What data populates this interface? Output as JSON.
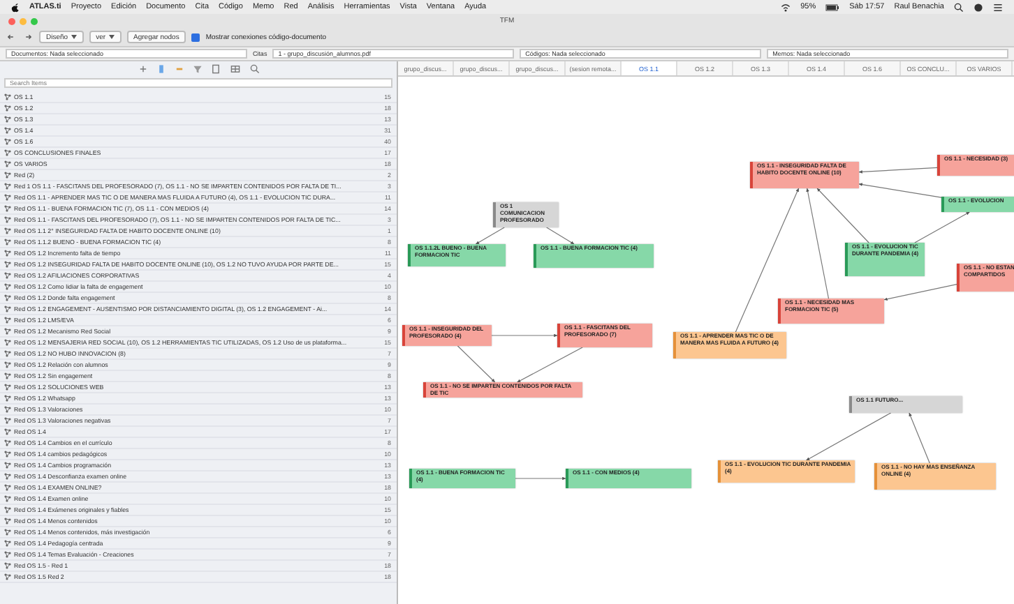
{
  "menu_bar": {
    "app": "ATLAS.ti",
    "items": [
      "Proyecto",
      "Edición",
      "Documento",
      "Cita",
      "Código",
      "Memo",
      "Red",
      "Análisis",
      "Herramientas",
      "Vista",
      "Ventana",
      "Ayuda"
    ],
    "battery": "95%",
    "clock": "Sáb 17:57",
    "user": "Raul Benachia"
  },
  "window": {
    "title": "TFM"
  },
  "toolbar": {
    "buttons": [
      {
        "label": "Diseño",
        "kind": "dropdown"
      },
      {
        "label": "ver",
        "kind": "dropdown"
      },
      {
        "label": "Agregar nodos",
        "kind": "button"
      }
    ],
    "checkbox": {
      "label": "Mostrar conexiones código-documento",
      "checked": true
    }
  },
  "filters": [
    {
      "value": "Documentos: Nada seleccionado"
    },
    {
      "label": "Citas",
      "value": "1 - grupo_discusión_alumnos.pdf"
    },
    {
      "value": "Códigos: Nada seleccionado"
    },
    {
      "value": "Memos: Nada seleccionado"
    }
  ],
  "sidebar": {
    "search": {
      "placeholder": "Search Items"
    },
    "items": [
      {
        "label": "OS 1.1",
        "count": "15"
      },
      {
        "label": "OS 1.2",
        "count": "18"
      },
      {
        "label": "OS 1.3",
        "count": "13"
      },
      {
        "label": "OS 1.4",
        "count": "31"
      },
      {
        "label": "OS 1.6",
        "count": "40"
      },
      {
        "label": "OS CONCLUSIONES FINALES",
        "count": "17"
      },
      {
        "label": "OS VARIOS",
        "count": "18"
      },
      {
        "label": "Red (2)",
        "count": "2"
      },
      {
        "label": "Red 1 OS 1.1 - FASCITANS DEL PROFESORADO (7), OS 1.1 - NO SE IMPARTEN CONTENIDOS POR FALTA DE TI...",
        "count": "3"
      },
      {
        "label": "Red OS 1.1 - APRENDER MAS TIC O DE MANERA MAS FLUIDA A FUTURO (4), OS 1.1 - EVOLUCION TIC DURA...",
        "count": "11"
      },
      {
        "label": "Red OS 1.1 - BUENA FORMACION TIC (7), OS 1.1 - CON MEDIOS (4)",
        "count": "14"
      },
      {
        "label": "Red OS 1.1 - FASCITANS DEL PROFESORADO (7), OS 1.1 - NO SE IMPARTEN CONTENIDOS POR FALTA DE TIC...",
        "count": "3"
      },
      {
        "label": "Red OS 1.1 2° INSEGURIDAD FALTA DE HABITO DOCENTE ONLINE (10)",
        "count": "1"
      },
      {
        "label": "Red OS 1.1.2 BUENO - BUENA FORMACION TIC (4)",
        "count": "8"
      },
      {
        "label": "Red OS 1.2 Incremento falta de tiempo",
        "count": "11"
      },
      {
        "label": "Red OS 1.2 INSEGURIDAD FALTA DE HABITO DOCENTE ONLINE (10), OS 1.2 NO TUVO AYUDA POR PARTE DE...",
        "count": "15"
      },
      {
        "label": "Red OS 1.2 AFILIACIONES CORPORATIVAS",
        "count": "4"
      },
      {
        "label": "Red OS 1.2 Como lidiar la falta de engagement",
        "count": "10"
      },
      {
        "label": "Red OS 1.2 Donde falta engagement",
        "count": "8"
      },
      {
        "label": "Red OS 1.2 ENGAGEMENT - AUSENTISMO POR DISTANCIAMIENTO DIGITAL (3), OS 1.2 ENGAGEMENT - Ai...",
        "count": "14"
      },
      {
        "label": "Red OS 1.2 LMS/EVA",
        "count": "6"
      },
      {
        "label": "Red OS 1.2 Mecanismo Red Social",
        "count": "9"
      },
      {
        "label": "Red OS 1.2 MENSAJERIA RED SOCIAL (10), OS 1.2 HERRAMIENTAS TIC UTILIZADAS, OS 1.2 Uso de us plataforma...",
        "count": "15"
      },
      {
        "label": "Red OS 1.2 NO HUBO INNOVACION (8)",
        "count": "7"
      },
      {
        "label": "Red OS 1.2 Relación con alumnos",
        "count": "9"
      },
      {
        "label": "Red OS 1.2 Sin engagement",
        "count": "8"
      },
      {
        "label": "Red OS 1.2 SOLUCIONES WEB",
        "count": "13"
      },
      {
        "label": "Red OS 1.2 Whatsapp",
        "count": "13"
      },
      {
        "label": "Red OS 1.3 Valoraciones",
        "count": "10"
      },
      {
        "label": "Red OS 1.3 Valoraciones negativas",
        "count": "7"
      },
      {
        "label": "Red OS 1.4",
        "count": "17"
      },
      {
        "label": "Red OS 1.4 Cambios en el currículo",
        "count": "8"
      },
      {
        "label": "Red OS 1.4 cambios pedagógicos",
        "count": "10"
      },
      {
        "label": "Red OS 1.4 Cambios programación",
        "count": "13"
      },
      {
        "label": "Red OS 1.4 Desconfianza examen online",
        "count": "13"
      },
      {
        "label": "Red OS 1.4 EXAMEN ONLINE?",
        "count": "18"
      },
      {
        "label": "Red OS 1.4 Examen online",
        "count": "10"
      },
      {
        "label": "Red OS 1.4 Exámenes originales y fiables",
        "count": "15"
      },
      {
        "label": "Red OS 1.4 Menos contenidos",
        "count": "10"
      },
      {
        "label": "Red OS 1.4 Menos contenidos, más investigación",
        "count": "6"
      },
      {
        "label": "Red OS 1.4 Pedagogía centrada",
        "count": "9"
      },
      {
        "label": "Red OS 1.4 Temas Evaluación - Creaciones",
        "count": "7"
      },
      {
        "label": "Red OS 1.5 - Red 1",
        "count": "18"
      },
      {
        "label": "Red OS 1.5 Red 2",
        "count": "18"
      }
    ]
  },
  "tabs": [
    {
      "label": "grupo_discus...",
      "selected": false
    },
    {
      "label": "grupo_discus...",
      "selected": false
    },
    {
      "label": "grupo_discus...",
      "selected": false
    },
    {
      "label": "(sesion remota...",
      "selected": false
    },
    {
      "label": "OS 1.1",
      "selected": true
    },
    {
      "label": "OS 1.2",
      "selected": false
    },
    {
      "label": "OS 1.3",
      "selected": false
    },
    {
      "label": "OS 1.4",
      "selected": false
    },
    {
      "label": "OS 1.6",
      "selected": false
    },
    {
      "label": "OS CONCLU...",
      "selected": false
    },
    {
      "label": "OS VARIOS",
      "selected": false
    }
  ],
  "network": {
    "nodes": [
      {
        "title": "OS 1 COMUNICACION PROFESORADO",
        "kind": "grey"
      },
      {
        "title": "OS 1.1.2L BUENO - BUENA FORMACION TIC",
        "kind": "green"
      },
      {
        "title": "OS 1.1 - BUENA FORMACION TIC (4)",
        "kind": "green"
      },
      {
        "title": "OS 1.1 - INSEGURIDAD FALTA DE HABITO DOCENTE ONLINE (10)",
        "kind": "red"
      },
      {
        "title": "OS 1.1 - NECESIDAD (3)",
        "kind": "red"
      },
      {
        "title": "OS 1.1 - EVOLUCION",
        "kind": "green"
      },
      {
        "title": "OS 1.1 - EVOLUCION TIC DURANTE PANDEMIA (4)",
        "kind": "green"
      },
      {
        "title": "OS 1.1 - NO ESTAN COMPARTIDOS",
        "kind": "red"
      },
      {
        "title": "OS 1.1 - NECESIDAD MAS FORMACION TIC (5)",
        "kind": "red"
      },
      {
        "title": "OS 1.1 - INSEGURIDAD DEL PROFESORADO (4)",
        "kind": "red"
      },
      {
        "title": "OS 1.1 - FASCITANS DEL PROFESORADO (7)",
        "kind": "red"
      },
      {
        "title": "OS 1.1 - NO SE IMPARTEN CONTENIDOS POR FALTA DE TIC",
        "kind": "red"
      },
      {
        "title": "OS 1.1 - APRENDER MAS TIC O DE MANERA MAS FLUIDA A FUTURO (4)",
        "kind": "orange"
      },
      {
        "title": "OS 1.1 FUTURO...",
        "kind": "grey"
      },
      {
        "title": "OS 1.1 - BUENA FORMACION TIC (4)",
        "kind": "green"
      },
      {
        "title": "OS 1.1 - CON MEDIOS (4)",
        "kind": "green"
      },
      {
        "title": "OS 1.1 - EVOLUCION TIC DURANTE PANDEMIA (4)",
        "kind": "orange"
      },
      {
        "title": "OS 1.1 - NO HAY MAS ENSEÑANZA ONLINE (4)",
        "kind": "orange"
      }
    ]
  }
}
